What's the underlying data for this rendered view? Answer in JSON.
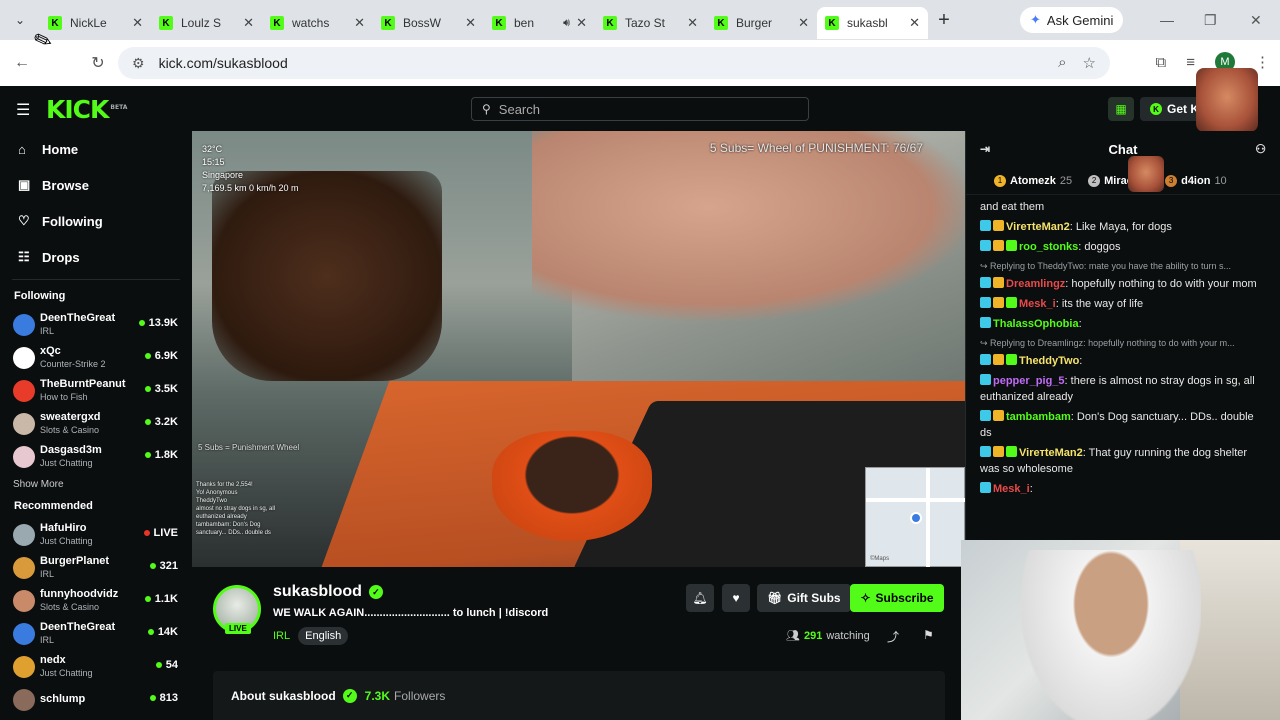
{
  "browser": {
    "tabs": [
      {
        "title": "NickLe",
        "active": false,
        "audio": false
      },
      {
        "title": "Loulz S",
        "active": false,
        "audio": false
      },
      {
        "title": "watchs",
        "active": false,
        "audio": false
      },
      {
        "title": "BossW",
        "active": false,
        "audio": false
      },
      {
        "title": "ben",
        "active": false,
        "audio": true
      },
      {
        "title": "Tazo St",
        "active": false,
        "audio": false
      },
      {
        "title": "Burger",
        "active": false,
        "audio": false
      },
      {
        "title": "sukasbl",
        "active": true,
        "audio": false
      }
    ],
    "gemini_label": "Ask Gemini",
    "url": "kick.com/sukasblood",
    "profile_initial": "M"
  },
  "kick": {
    "logo": "KICK",
    "logo_beta": "BETA",
    "search_placeholder": "Search",
    "get_kick_label": "Get KICK",
    "accent": "#53fc18"
  },
  "sidebar": {
    "nav": [
      {
        "label": "Home",
        "icon": "home-icon"
      },
      {
        "label": "Browse",
        "icon": "browse-icon"
      },
      {
        "label": "Following",
        "icon": "heart-icon"
      },
      {
        "label": "Drops",
        "icon": "drops-icon"
      }
    ],
    "following_title": "Following",
    "following": [
      {
        "name": "DeenTheGreat",
        "category": "IRL",
        "viewers": "13.9K",
        "color": "#3a7be0"
      },
      {
        "name": "xQc",
        "category": "Counter-Strike 2",
        "viewers": "6.9K",
        "color": "#ffffff"
      },
      {
        "name": "TheBurntPeanut",
        "category": "How to Fish",
        "viewers": "3.5K",
        "color": "#e83b2a"
      },
      {
        "name": "sweatergxd",
        "category": "Slots & Casino",
        "viewers": "3.2K",
        "color": "#c9b8a8"
      },
      {
        "name": "Dasgasd3m",
        "category": "Just Chatting",
        "viewers": "1.8K",
        "color": "#e8c8d0"
      }
    ],
    "show_more": "Show More",
    "recommended_title": "Recommended",
    "recommended": [
      {
        "name": "HafuHiro",
        "category": "Just Chatting",
        "viewers": "LIVE",
        "color": "#9aa8b0"
      },
      {
        "name": "BurgerPlanet",
        "category": "IRL",
        "viewers": "321",
        "color": "#d89a3a"
      },
      {
        "name": "funnyhoodvidz",
        "category": "Slots & Casino",
        "viewers": "1.1K",
        "color": "#c98a6a"
      },
      {
        "name": "DeenTheGreat",
        "category": "IRL",
        "viewers": "14K",
        "color": "#3a7be0"
      },
      {
        "name": "nedx",
        "category": "Just Chatting",
        "viewers": "54",
        "color": "#e0a030"
      },
      {
        "name": "schlump",
        "category": "",
        "viewers": "813",
        "color": "#8a6a5a"
      }
    ]
  },
  "video": {
    "weather": [
      "32°C",
      "15:15",
      "Singapore",
      "7,169.5 km  0 km/h  20 m"
    ],
    "wheel_text": "5 Subs= Wheel of PUNISHMENT: 76/67",
    "subs_text": "5 Subs = Punishment Wheel",
    "overlay_chat": [
      "Thanks for the 2,554!",
      "Yo! Anonymous",
      "TheddyTwo",
      "almost no stray dogs in sg, all",
      "euthanized already",
      "tambambam: Don's Dog",
      "sanctuary... DDs.. double ds"
    ]
  },
  "stream": {
    "name": "sukasblood",
    "live": "LIVE",
    "title": "WE WALK AGAIN............................ to lunch  | !discord",
    "category": "IRL",
    "language": "English",
    "gift_label": "Gift Subs",
    "subscribe_label": "Subscribe",
    "viewers": "291",
    "watching_label": "watching",
    "about_label": "About sukasblood",
    "followers": "7.3K",
    "followers_label": "Followers"
  },
  "chat": {
    "title": "Chat",
    "gifters": [
      {
        "rank": "1",
        "name": "Atomezk",
        "count": "25",
        "color": "#f0b429"
      },
      {
        "rank": "2",
        "name": "Mirac",
        "count": "10",
        "color": "#c0c0c0"
      },
      {
        "rank": "3",
        "name": "d4ion",
        "count": "10",
        "color": "#cd7f32"
      }
    ],
    "messages": [
      {
        "type": "msg",
        "user": "",
        "color": "#fff",
        "text": "and eat them"
      },
      {
        "type": "msg",
        "user": "VirетteMan2",
        "color": "#f5e36b",
        "text": "Like Maya, for dogs"
      },
      {
        "type": "msg",
        "user": "roo_stonks",
        "color": "#53fc18",
        "text": "doggos"
      },
      {
        "type": "reply",
        "text": "Replying to TheddyTwo: mate you have the ability to turn s..."
      },
      {
        "type": "msg",
        "user": "Dreamlingz",
        "color": "#e84a4a",
        "text": "hopefully nothing to do with your mom"
      },
      {
        "type": "msg",
        "user": "Mesk_i",
        "color": "#e84a4a",
        "text": "its the way of life"
      },
      {
        "type": "msg",
        "user": "ThalassOphobia",
        "color": "#53fc18",
        "text": ""
      },
      {
        "type": "reply",
        "text": "Replying to Dreamlingz: hopefully nothing to do with your m..."
      },
      {
        "type": "msg",
        "user": "TheddyTwo",
        "color": "#f5e36b",
        "text": ""
      },
      {
        "type": "msg",
        "user": "pepper_pig_5",
        "color": "#c06bf5",
        "text": "there is almost no stray dogs in sg, all euthanized already"
      },
      {
        "type": "msg",
        "user": "tambambam",
        "color": "#53fc18",
        "text": "Don's Dog sanctuary... DDs.. double ds"
      },
      {
        "type": "msg",
        "user": "VirетteMan2",
        "color": "#f5e36b",
        "text": "That guy running the dog shelter was so wholesome"
      },
      {
        "type": "msg",
        "user": "Mesk_i",
        "color": "#e84a4a",
        "text": ""
      }
    ]
  }
}
